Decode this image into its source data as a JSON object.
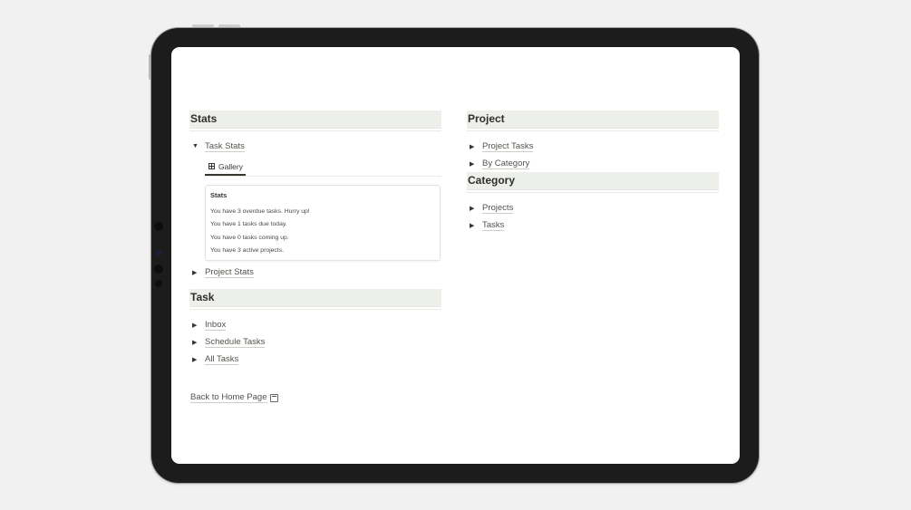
{
  "left": {
    "stats": {
      "heading": "Stats",
      "task_stats": {
        "label": "Task Stats",
        "view_tab": "Gallery",
        "card": {
          "title": "Stats",
          "lines": [
            "You have 3 overdue tasks. Hurry up!",
            "You have 1 tasks due today.",
            "You have 0 tasks coming up.",
            "You have 3 active projects."
          ]
        }
      },
      "project_stats": "Project Stats"
    },
    "task": {
      "heading": "Task",
      "items": [
        "Inbox",
        "Schedule Tasks",
        "All Tasks"
      ]
    }
  },
  "right": {
    "project": {
      "heading": "Project",
      "items": [
        "Project Tasks",
        "By Category"
      ]
    },
    "category": {
      "heading": "Category",
      "items": [
        "Projects",
        "Tasks"
      ]
    }
  },
  "footer": {
    "back_link": "Back to Home Page",
    "back_icon": "back-arrow-icon"
  },
  "colors": {
    "heading_bg": "#edf0ea",
    "device_frame": "#1c1c1c",
    "page_bg": "#f1f1f1"
  }
}
